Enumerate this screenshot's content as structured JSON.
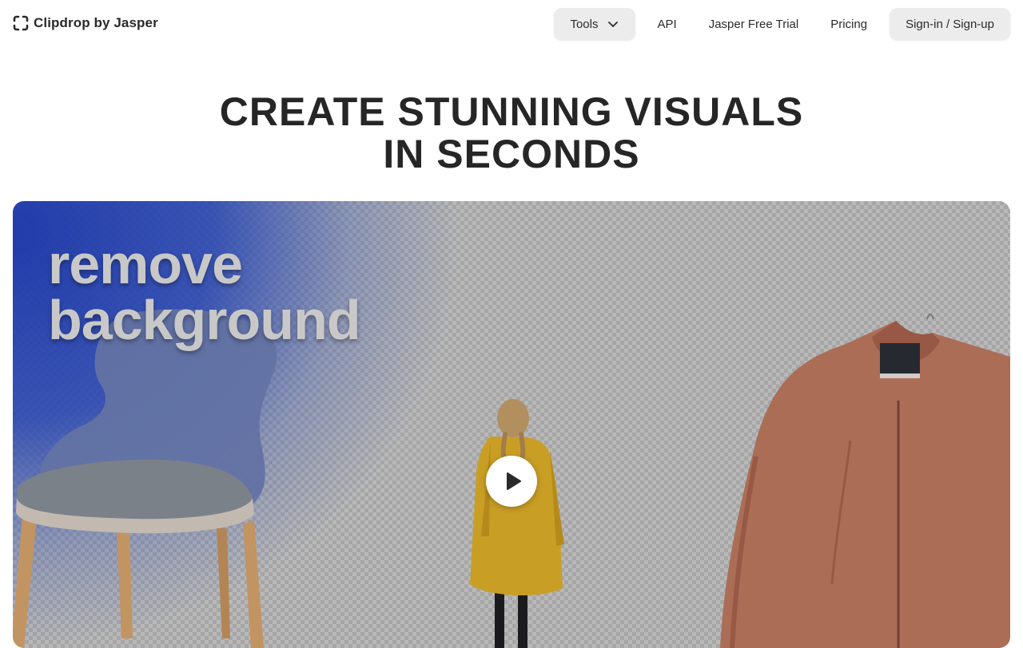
{
  "brand": {
    "name": "Clipdrop by Jasper",
    "icon": "clipdrop-logo-icon"
  },
  "nav": {
    "tools_label": "Tools",
    "tools_icon": "chevron-down-icon",
    "api_label": "API",
    "trial_label": "Jasper Free Trial",
    "pricing_label": "Pricing",
    "signin_label": "Sign-in / Sign-up"
  },
  "hero": {
    "title_line1": "CREATE STUNNING VISUALS",
    "title_line2": "IN SECONDS"
  },
  "media": {
    "caption_line1": "remove",
    "caption_line2": "background",
    "play_icon": "play-icon",
    "colors": {
      "glow": "#2a4fd0",
      "jacket": "#c07a60",
      "coat": "#e0b02a",
      "chair_seat": "#8a9099",
      "chair_wood": "#d9a56e"
    }
  }
}
